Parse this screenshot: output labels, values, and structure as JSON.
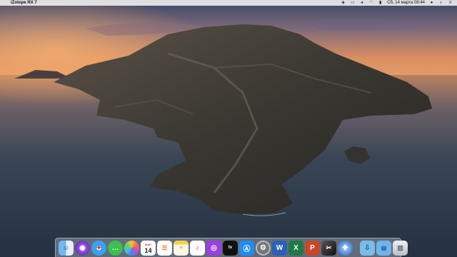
{
  "menubar": {
    "app_name": "iZotope RX 7",
    "apple_icon": "",
    "clock": "Сб, 14 марта  08:44",
    "status_icons": [
      "dropbox-icon",
      "screen-mirror-icon",
      "volume-icon",
      "wifi-icon",
      "battery-icon",
      "siri-icon",
      "spotlight-icon",
      "control-center-icon"
    ]
  },
  "dock": {
    "calendar": {
      "month": "МАР",
      "day": "14"
    },
    "apps": [
      "finder",
      "siri",
      "safari",
      "messages",
      "photos",
      "calendar",
      "reminders",
      "notes",
      "music",
      "podcasts",
      "apple-tv",
      "app-store",
      "system-preferences",
      "word",
      "excel",
      "powerpoint",
      "final-cut-pro",
      "izotope-rx",
      "downloads-folder",
      "documents-folder",
      "trash"
    ]
  },
  "colors": {
    "sky_top": "#3f4a6a",
    "sky_horizon": "#e49a5c",
    "sea": "#2f3c4c",
    "island": "#3a3a36"
  }
}
